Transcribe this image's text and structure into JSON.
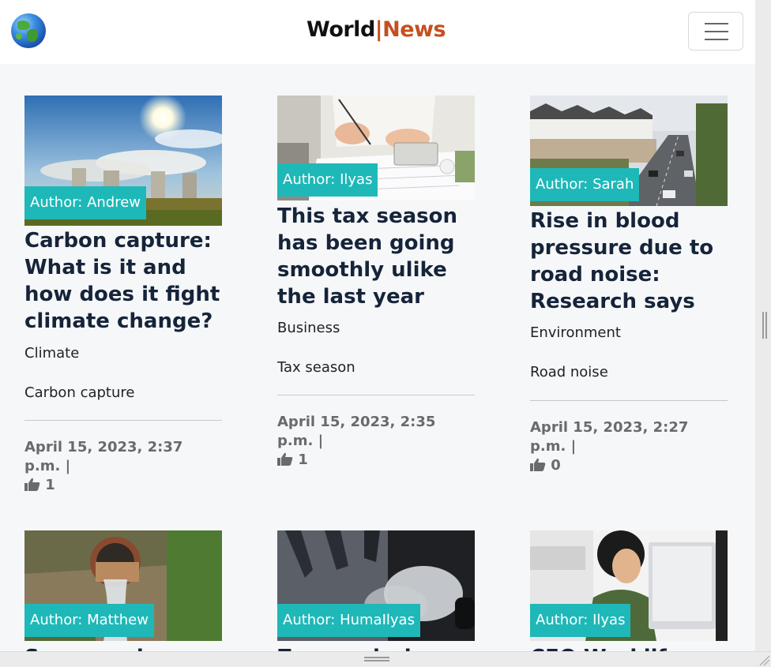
{
  "brand": {
    "part1": "World",
    "separator": "|",
    "part2": "News"
  },
  "articles": [
    {
      "author": "Author: Andrew",
      "title": "Carbon capture: What is it and how does it fight climate change?",
      "category": "Climate",
      "tag": "Carbon capture",
      "date": "April 15, 2023, 2:37 p.m. |",
      "likes": "1"
    },
    {
      "author": "Author: Ilyas",
      "title": "This tax season has been going smoothly ulike the last year",
      "category": "Business",
      "tag": "Tax season",
      "date": "April 15, 2023, 2:35 p.m. |",
      "likes": "1"
    },
    {
      "author": "Author: Sarah",
      "title": "Rise in blood pressure due to road noise: Research says",
      "category": "Environment",
      "tag": "Road noise",
      "date": "April 15, 2023, 2:27 p.m. |",
      "likes": "0"
    },
    {
      "author": "Author: Matthew",
      "title": "Sewage pipe...",
      "category": "",
      "tag": "",
      "date": "",
      "likes": ""
    },
    {
      "author": "Author: HumaIlyas",
      "title": "Zero emission...",
      "category": "",
      "tag": "",
      "date": "",
      "likes": ""
    },
    {
      "author": "Author: Ilyas",
      "title": "CEO Worklife...",
      "category": "",
      "tag": "",
      "date": "",
      "likes": ""
    }
  ],
  "colors": {
    "accent": "#1fb8b8",
    "brand_red": "#c4501f",
    "title": "#16243a"
  },
  "icons": {
    "logo": "globe-icon",
    "menu": "hamburger-menu-icon",
    "like": "thumbs-up-icon"
  }
}
